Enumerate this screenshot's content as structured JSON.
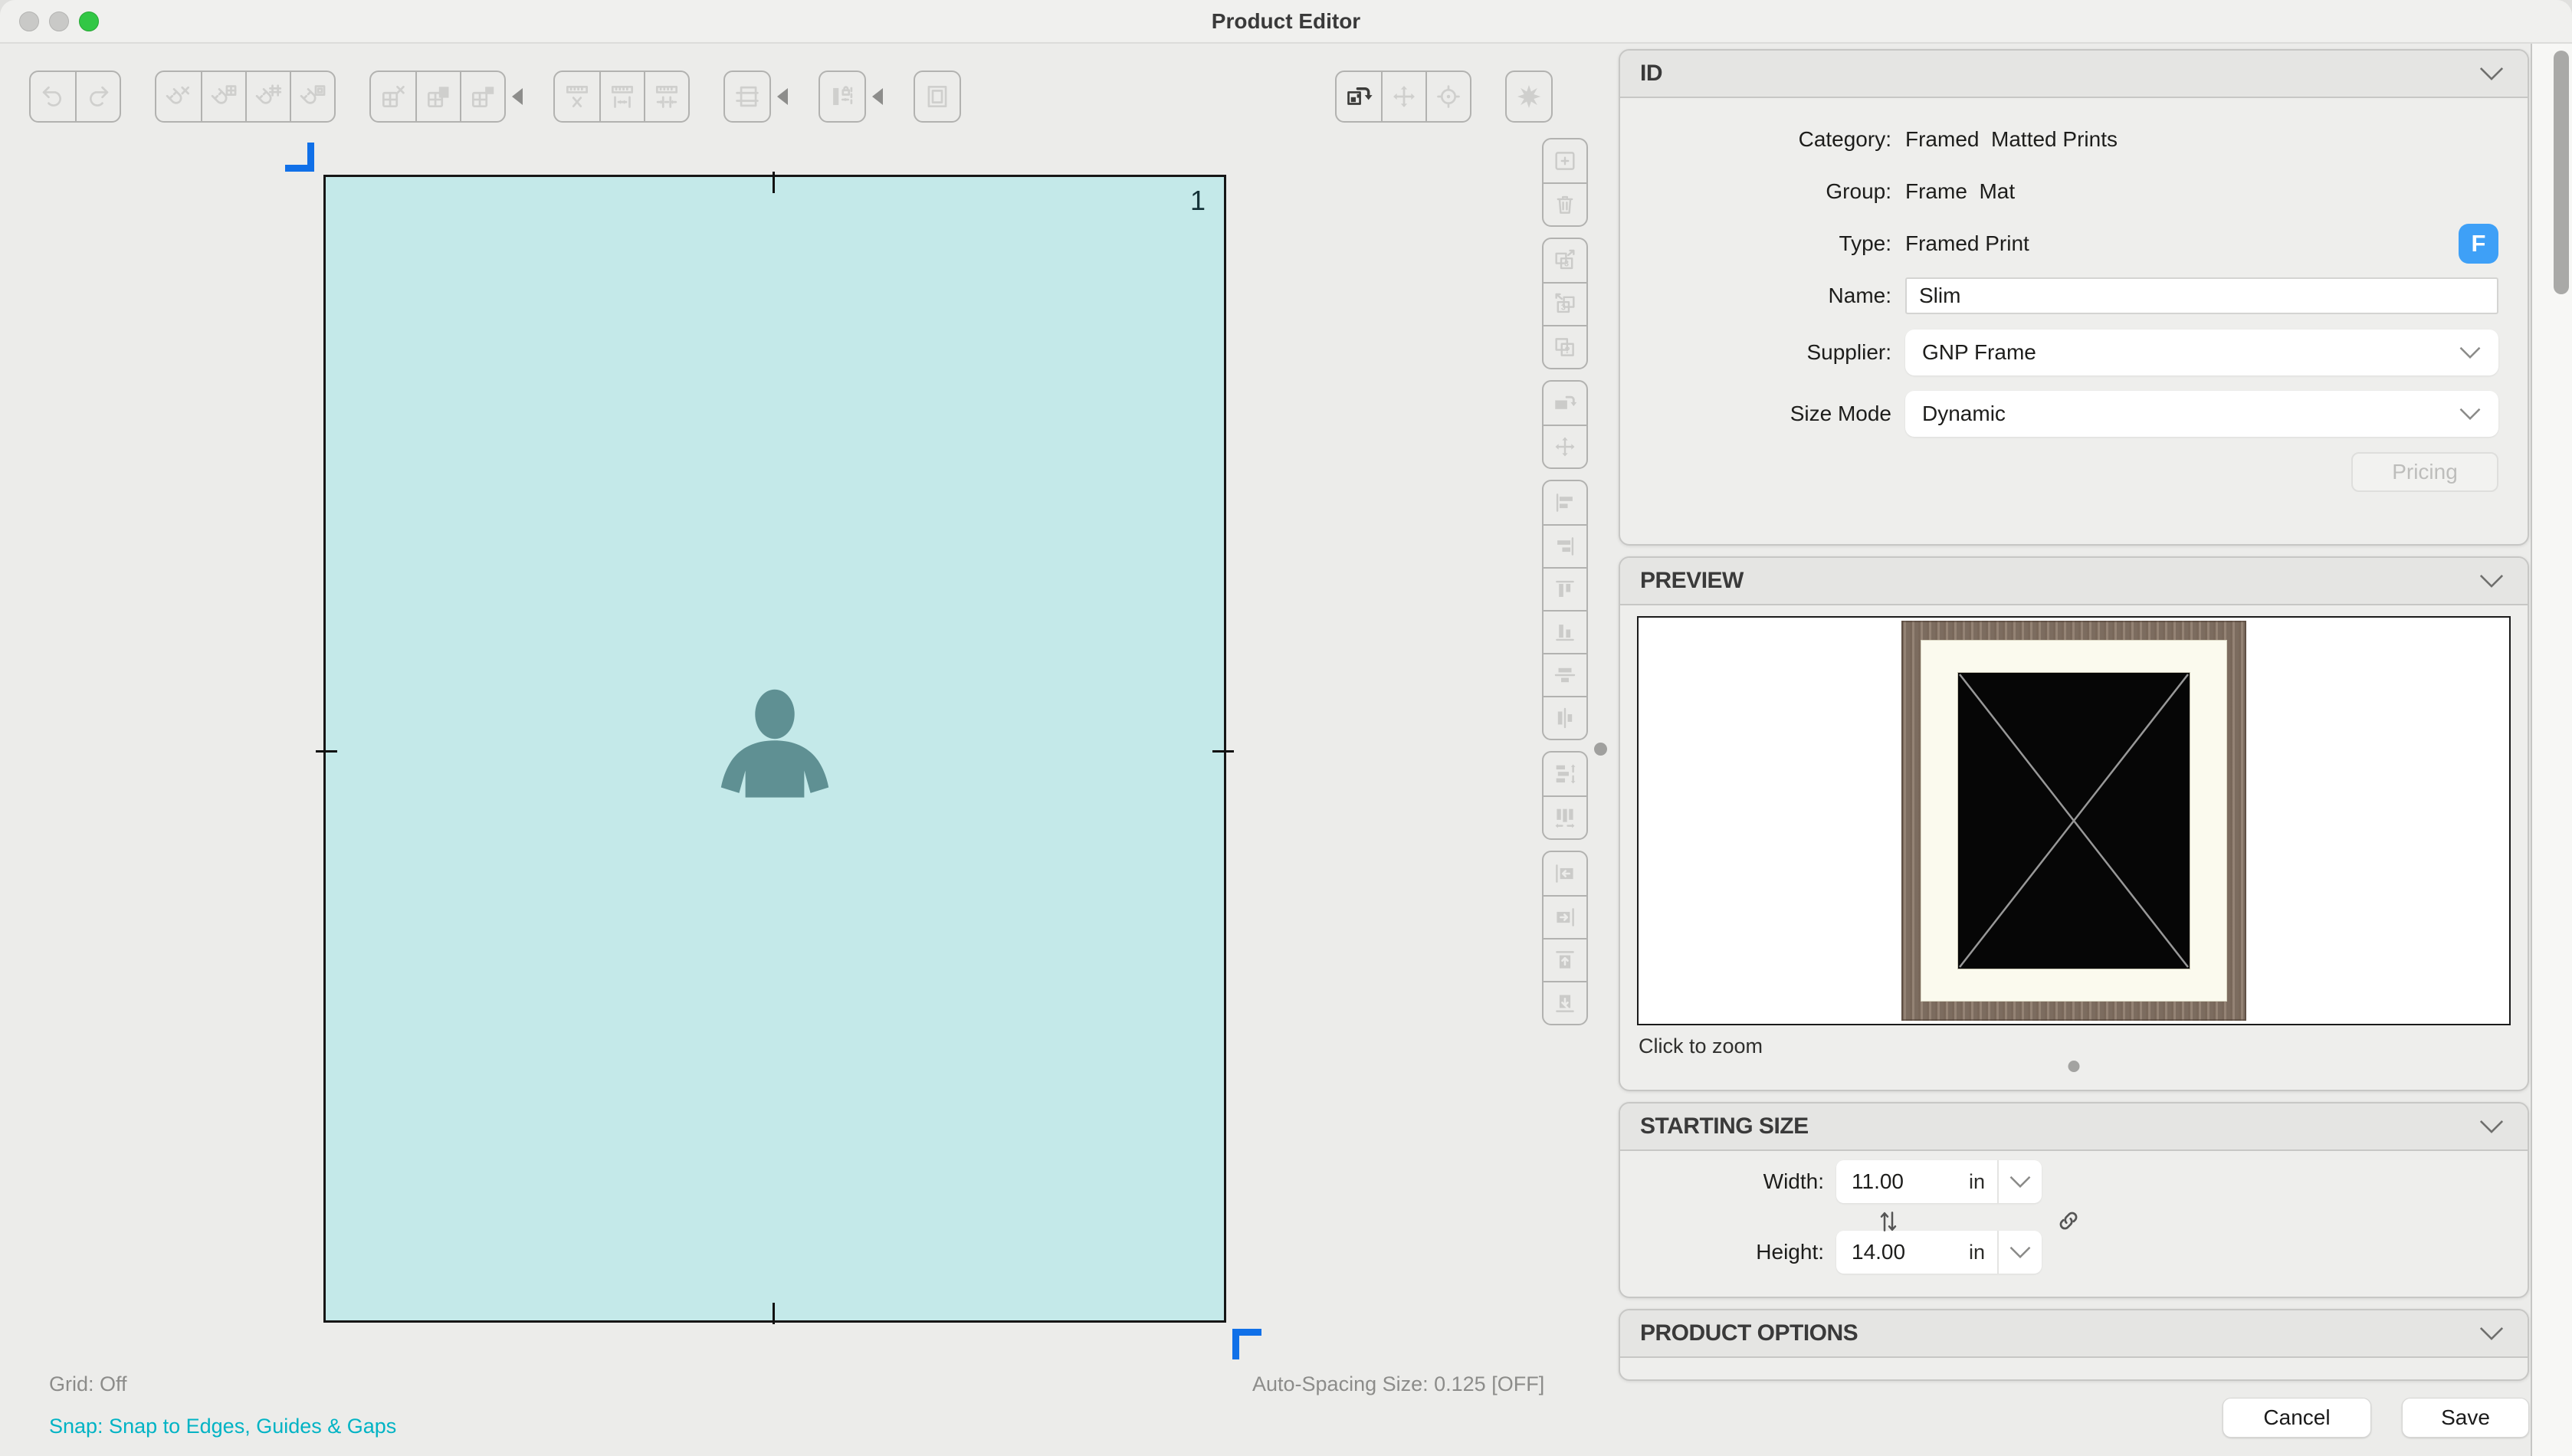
{
  "window": {
    "title": "Product Editor"
  },
  "top_toolbar": {
    "left_groups": [
      {
        "buttons": [
          {
            "icon": "undo"
          },
          {
            "icon": "redo"
          }
        ]
      },
      {
        "buttons": [
          {
            "icon": "snap-off"
          },
          {
            "icon": "snap-grid"
          },
          {
            "icon": "snap-guides"
          },
          {
            "icon": "snap-frame"
          }
        ]
      },
      {
        "flyout": true,
        "buttons": [
          {
            "icon": "grid-delete"
          },
          {
            "icon": "grid-fill"
          },
          {
            "icon": "grid-corner"
          }
        ]
      },
      {
        "buttons": [
          {
            "icon": "spacing-off"
          },
          {
            "icon": "spacing-inner"
          },
          {
            "icon": "spacing-outer"
          }
        ]
      },
      {
        "flyout": true,
        "buttons": [
          {
            "icon": "guides"
          }
        ]
      },
      {
        "flyout": true,
        "buttons": [
          {
            "icon": "margin-lock"
          }
        ]
      },
      {
        "buttons": [
          {
            "icon": "frame-outline"
          }
        ]
      }
    ],
    "right_groups": [
      {
        "buttons": [
          {
            "icon": "rotate-canvas",
            "enabled": true
          },
          {
            "icon": "move-canvas"
          },
          {
            "icon": "center-canvas"
          }
        ]
      },
      {
        "buttons": [
          {
            "icon": "effects"
          }
        ]
      }
    ]
  },
  "side_toolbar": {
    "groups": [
      {
        "buttons": [
          {
            "icon": "frame-add"
          },
          {
            "icon": "frame-delete"
          }
        ]
      },
      {
        "buttons": [
          {
            "icon": "copy-next"
          },
          {
            "icon": "copy-prev"
          },
          {
            "icon": "copy-unknown"
          }
        ]
      },
      {
        "buttons": [
          {
            "icon": "frame-rotate"
          },
          {
            "icon": "frame-move"
          }
        ]
      },
      {
        "buttons": [
          {
            "icon": "align-left"
          },
          {
            "icon": "align-right"
          },
          {
            "icon": "align-top"
          },
          {
            "icon": "align-bottom"
          },
          {
            "icon": "align-center-v"
          },
          {
            "icon": "align-center-h"
          }
        ]
      },
      {
        "buttons": [
          {
            "icon": "distribute-v"
          },
          {
            "icon": "distribute-h"
          }
        ]
      },
      {
        "buttons": [
          {
            "icon": "push-left"
          },
          {
            "icon": "push-right"
          },
          {
            "icon": "push-up"
          },
          {
            "icon": "push-down"
          }
        ]
      }
    ]
  },
  "canvas": {
    "frame_label": "1"
  },
  "statusbar": {
    "grid": "Grid: Off",
    "snap": "Snap: Snap to Edges, Guides & Gaps",
    "auto_spacing": "Auto-Spacing Size: 0.125 [OFF]"
  },
  "panels": {
    "id": {
      "title": "ID",
      "category_label": "Category:",
      "category_value": "Framed  Matted Prints",
      "group_label": "Group:",
      "group_value": "Frame  Mat",
      "type_label": "Type:",
      "type_value": "Framed Print",
      "type_badge": "F",
      "name_label": "Name:",
      "name_value": "Slim",
      "supplier_label": "Supplier:",
      "supplier_value": "GNP Frame",
      "size_mode_label": "Size Mode",
      "size_mode_value": "Dynamic",
      "pricing_button": "Pricing"
    },
    "preview": {
      "title": "PREVIEW",
      "hint": "Click to zoom"
    },
    "starting_size": {
      "title": "STARTING SIZE",
      "width_label": "Width:",
      "width_value": "11.00",
      "width_unit": "in",
      "height_label": "Height:",
      "height_value": "14.00",
      "height_unit": "in"
    },
    "product_options": {
      "title": "PRODUCT OPTIONS"
    }
  },
  "footer": {
    "cancel_label": "Cancel",
    "save_label": "Save"
  },
  "colors": {
    "accent_blue": "#1070e8",
    "badge_blue": "#3ea0f7",
    "snap_cyan": "#00b3c4",
    "canvas_fill": "#c4e9e9",
    "person_icon": "#5f9093",
    "frame_wood": "#8d7b6c",
    "mat_cream": "#fbfaee"
  }
}
